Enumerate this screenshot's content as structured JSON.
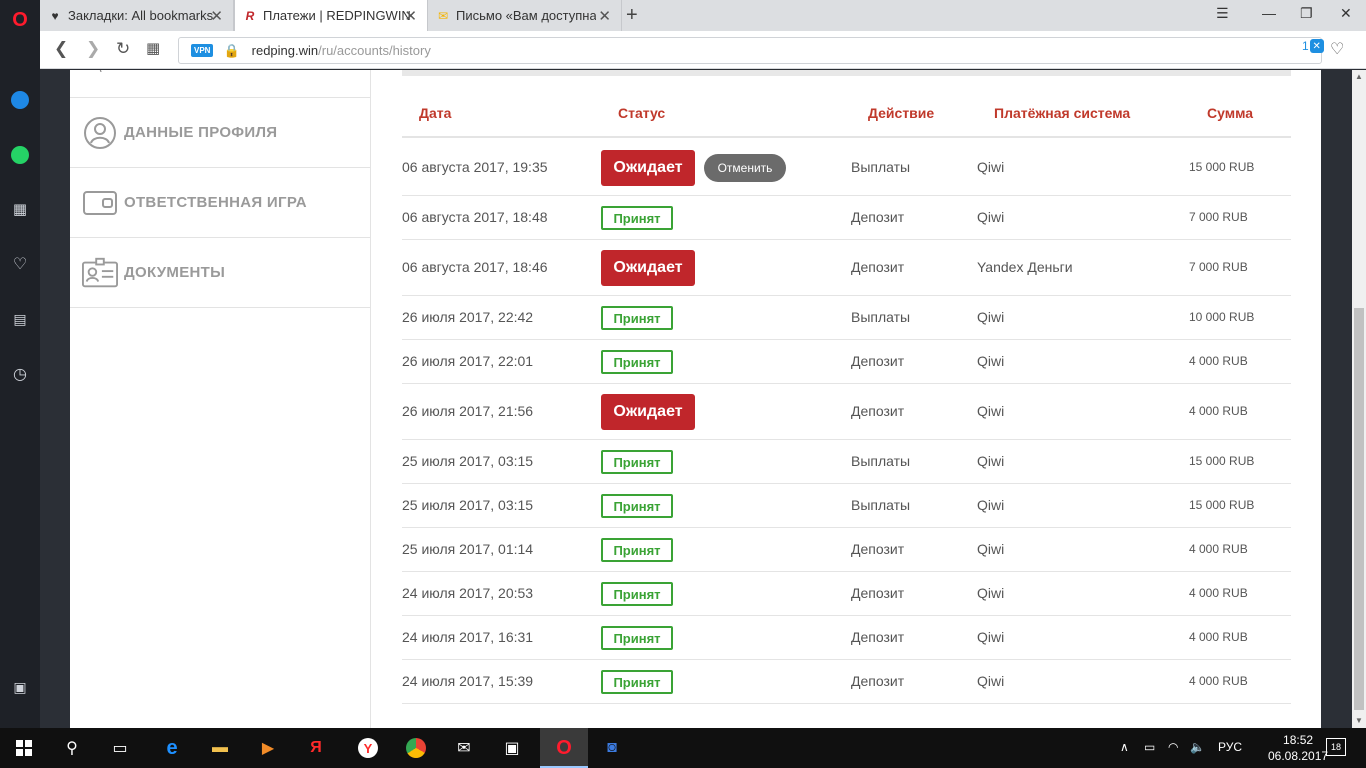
{
  "browser": {
    "tabs": [
      {
        "title": "Закладки: All bookmarks",
        "icon": "heart-icon"
      },
      {
        "title": "Платежи | REDPINGWIN",
        "icon": "redpingwin-icon"
      },
      {
        "title": "Письмо «Вам доступна бе",
        "icon": "mail-icon"
      }
    ],
    "url_host": "redping.win",
    "url_path": "/ru/accounts/history",
    "vpn_label": "VPN",
    "extension_count": "1"
  },
  "sidebar": {
    "items": [
      {
        "label": "ДАННЫЕ ПРОФИЛЯ",
        "icon": "profile-icon"
      },
      {
        "label": "ОТВЕТСТВЕННАЯ ИГРА",
        "icon": "wallet-icon"
      },
      {
        "label": "ДОКУМЕНТЫ",
        "icon": "id-card-icon"
      }
    ]
  },
  "table": {
    "headers": {
      "date": "Дата",
      "status": "Статус",
      "action": "Действие",
      "system": "Платёжная система",
      "amount": "Сумма"
    },
    "cancel_label": "Отменить",
    "rows": [
      {
        "date": "06 августа 2017, 19:35",
        "status": "Ожидает",
        "action": "Выплаты",
        "system": "Qiwi",
        "amount": "15 000 RUB"
      },
      {
        "date": "06 августа 2017, 18:48",
        "status": "Принят",
        "action": "Депозит",
        "system": "Qiwi",
        "amount": "7 000 RUB"
      },
      {
        "date": "06 августа 2017, 18:46",
        "status": "Ожидает",
        "action": "Депозит",
        "system": "Yandex Деньги",
        "amount": "7 000 RUB"
      },
      {
        "date": "26 июля 2017, 22:42",
        "status": "Принят",
        "action": "Выплаты",
        "system": "Qiwi",
        "amount": "10 000 RUB"
      },
      {
        "date": "26 июля 2017, 22:01",
        "status": "Принят",
        "action": "Депозит",
        "system": "Qiwi",
        "amount": "4 000 RUB"
      },
      {
        "date": "26 июля 2017, 21:56",
        "status": "Ожидает",
        "action": "Депозит",
        "system": "Qiwi",
        "amount": "4 000 RUB"
      },
      {
        "date": "25 июля 2017, 03:15",
        "status": "Принят",
        "action": "Выплаты",
        "system": "Qiwi",
        "amount": "15 000 RUB"
      },
      {
        "date": "25 июля 2017, 03:15",
        "status": "Принят",
        "action": "Выплаты",
        "system": "Qiwi",
        "amount": "15 000 RUB"
      },
      {
        "date": "25 июля 2017, 01:14",
        "status": "Принят",
        "action": "Депозит",
        "system": "Qiwi",
        "amount": "4 000 RUB"
      },
      {
        "date": "24 июля 2017, 20:53",
        "status": "Принят",
        "action": "Депозит",
        "system": "Qiwi",
        "amount": "4 000 RUB"
      },
      {
        "date": "24 июля 2017, 16:31",
        "status": "Принят",
        "action": "Депозит",
        "system": "Qiwi",
        "amount": "4 000 RUB"
      },
      {
        "date": "24 июля 2017, 15:39",
        "status": "Принят",
        "action": "Депозит",
        "system": "Qiwi",
        "amount": "4 000 RUB"
      }
    ]
  },
  "taskbar": {
    "language": "РУС",
    "time": "18:52",
    "date": "06.08.2017",
    "notifications": "18"
  },
  "colors": {
    "accent": "#c0392b",
    "pending": "#c0262b",
    "accepted": "#3aa335"
  }
}
